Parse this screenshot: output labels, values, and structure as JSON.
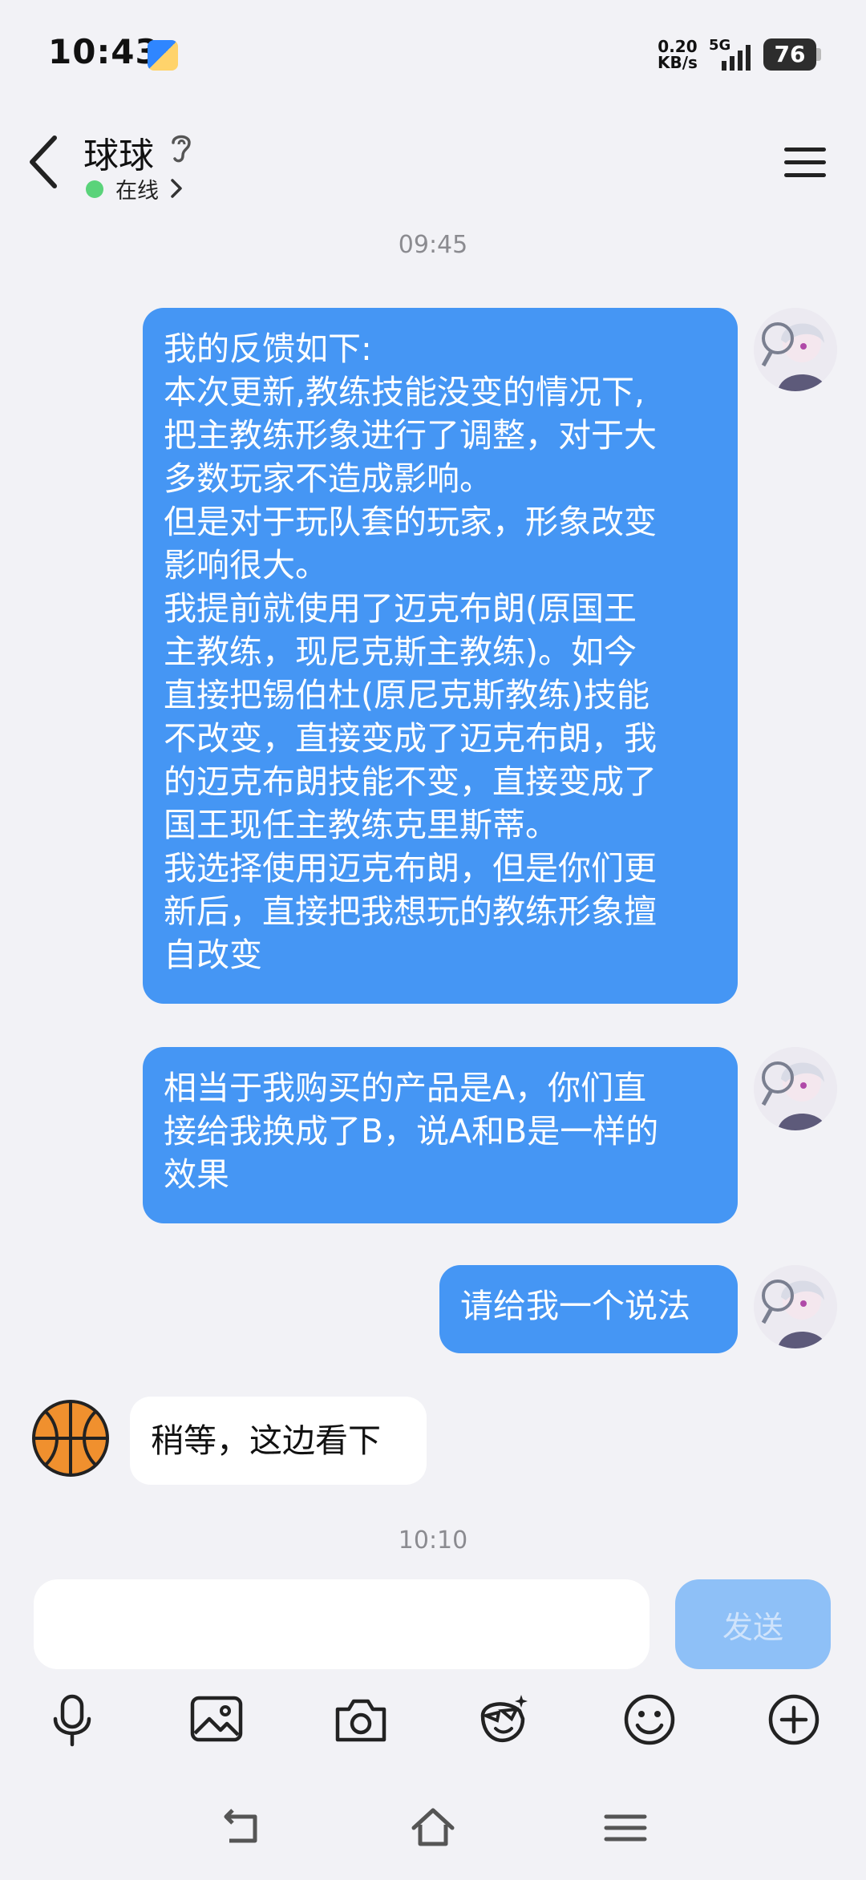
{
  "status_bar": {
    "time": "10:43",
    "net_speed_value": "0.20",
    "net_speed_unit": "KB/s",
    "network": "5G",
    "battery": "76"
  },
  "header": {
    "contact_name": "球球",
    "status": "在线"
  },
  "messages": [
    {
      "type": "time",
      "text": "09:45"
    },
    {
      "type": "outgoing",
      "lines": [
        "我的反馈如下:",
        "本次更新,教练技能没变的情况下,",
        "把主教练形象进行了调整，对于大",
        "多数玩家不造成影响。",
        "但是对于玩队套的玩家，形象改变",
        "影响很大。",
        "我提前就使用了迈克布朗(原国王",
        "主教练，现尼克斯主教练)。如今",
        "直接把锡伯杜(原尼克斯教练)技能",
        "不改变，直接变成了迈克布朗，我",
        "的迈克布朗技能不变，直接变成了",
        "国王现任主教练克里斯蒂。",
        "我选择使用迈克布朗，但是你们更",
        "新后，直接把我想玩的教练形象擅",
        "自改变"
      ]
    },
    {
      "type": "outgoing",
      "lines": [
        "相当于我购买的产品是A，你们直",
        "接给我换成了B，说A和B是一样的",
        "效果"
      ]
    },
    {
      "type": "outgoing",
      "lines": [
        "请给我一个说法"
      ]
    },
    {
      "type": "incoming",
      "lines": [
        "稍等，这边看下"
      ]
    },
    {
      "type": "time",
      "text": "10:10"
    }
  ],
  "input": {
    "value": "",
    "send_label": "发送"
  },
  "toolbar": [
    "microphone-icon",
    "image-icon",
    "camera-icon",
    "sticker-face-icon",
    "emoji-icon",
    "plus-icon"
  ],
  "colors": {
    "outgoing_bubble": "#4596f4",
    "incoming_bubble": "#ffffff",
    "background": "#f2f2f6",
    "online": "#5ad37a",
    "send_button": "#8ec0f7"
  }
}
